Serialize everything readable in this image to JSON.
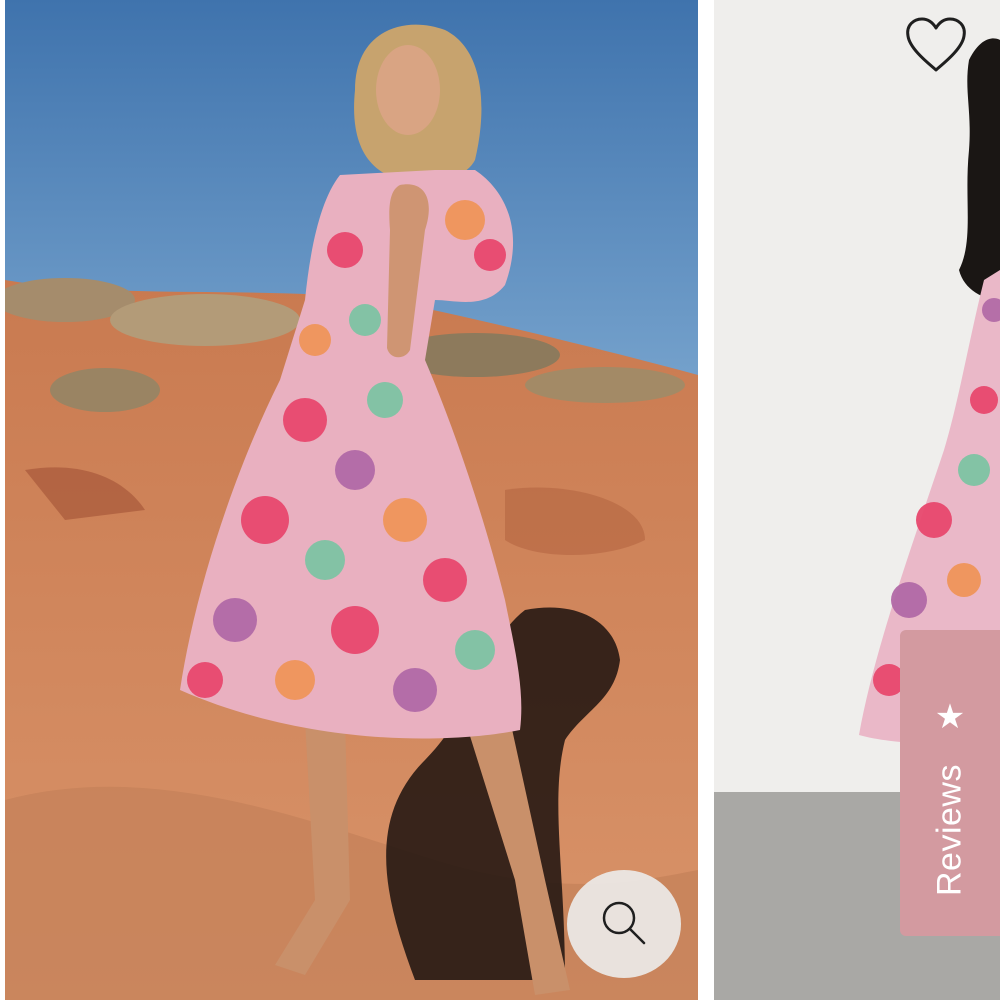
{
  "gallery": {
    "main_image_alt": "",
    "side_image_alt": ""
  },
  "reviews_tab": {
    "label": "Reviews",
    "icon": "star-icon"
  },
  "controls": {
    "zoom_icon": "magnifier-icon",
    "wishlist_icon": "heart-outline-icon"
  },
  "colors": {
    "reviews_tab_bg": "#d39aa0",
    "zoom_button_bg": "#eceae8"
  }
}
